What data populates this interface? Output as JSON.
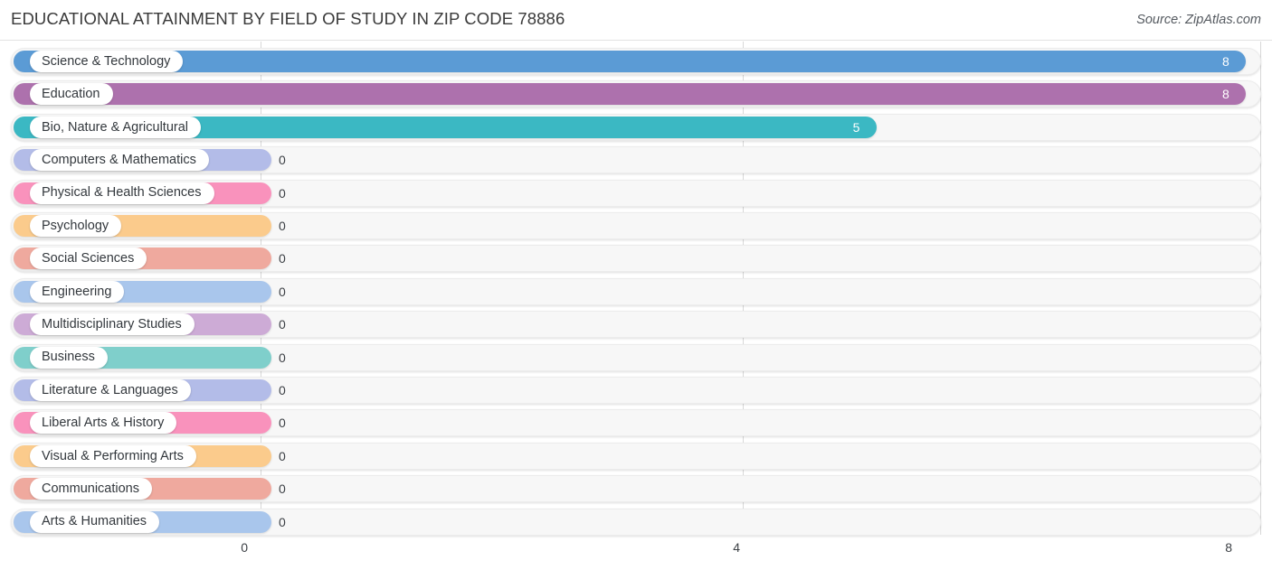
{
  "header": {
    "title": "EDUCATIONAL ATTAINMENT BY FIELD OF STUDY IN ZIP CODE 78886",
    "source": "Source: ZipAtlas.com"
  },
  "chart_data": {
    "type": "bar",
    "orientation": "horizontal",
    "title": "EDUCATIONAL ATTAINMENT BY FIELD OF STUDY IN ZIP CODE 78886",
    "xlabel": "",
    "ylabel": "",
    "xlim": [
      0,
      8
    ],
    "grid": true,
    "gridlines": [
      0,
      4,
      8
    ],
    "xticks": [
      "0",
      "4",
      "8"
    ],
    "legend": false,
    "categories": [
      "Science & Technology",
      "Education",
      "Bio, Nature & Agricultural",
      "Computers & Mathematics",
      "Physical & Health Sciences",
      "Psychology",
      "Social Sciences",
      "Engineering",
      "Multidisciplinary Studies",
      "Business",
      "Literature & Languages",
      "Liberal Arts & History",
      "Visual & Performing Arts",
      "Communications",
      "Arts & Humanities"
    ],
    "values": [
      8,
      8,
      5,
      0,
      0,
      0,
      0,
      0,
      0,
      0,
      0,
      0,
      0,
      0,
      0
    ],
    "value_labels": [
      "8",
      "8",
      "5",
      "0",
      "0",
      "0",
      "0",
      "0",
      "0",
      "0",
      "0",
      "0",
      "0",
      "0",
      "0"
    ],
    "colors": [
      "#5b9bd5",
      "#ad71ad",
      "#3bb8c3",
      "#b3bce8",
      "#f992bc",
      "#fbcb8c",
      "#efa99e",
      "#a9c6ec",
      "#cdabd6",
      "#7fcfcb",
      "#b3bce8",
      "#f992bc",
      "#fbcb8c",
      "#efa99e",
      "#a9c6ec"
    ]
  }
}
